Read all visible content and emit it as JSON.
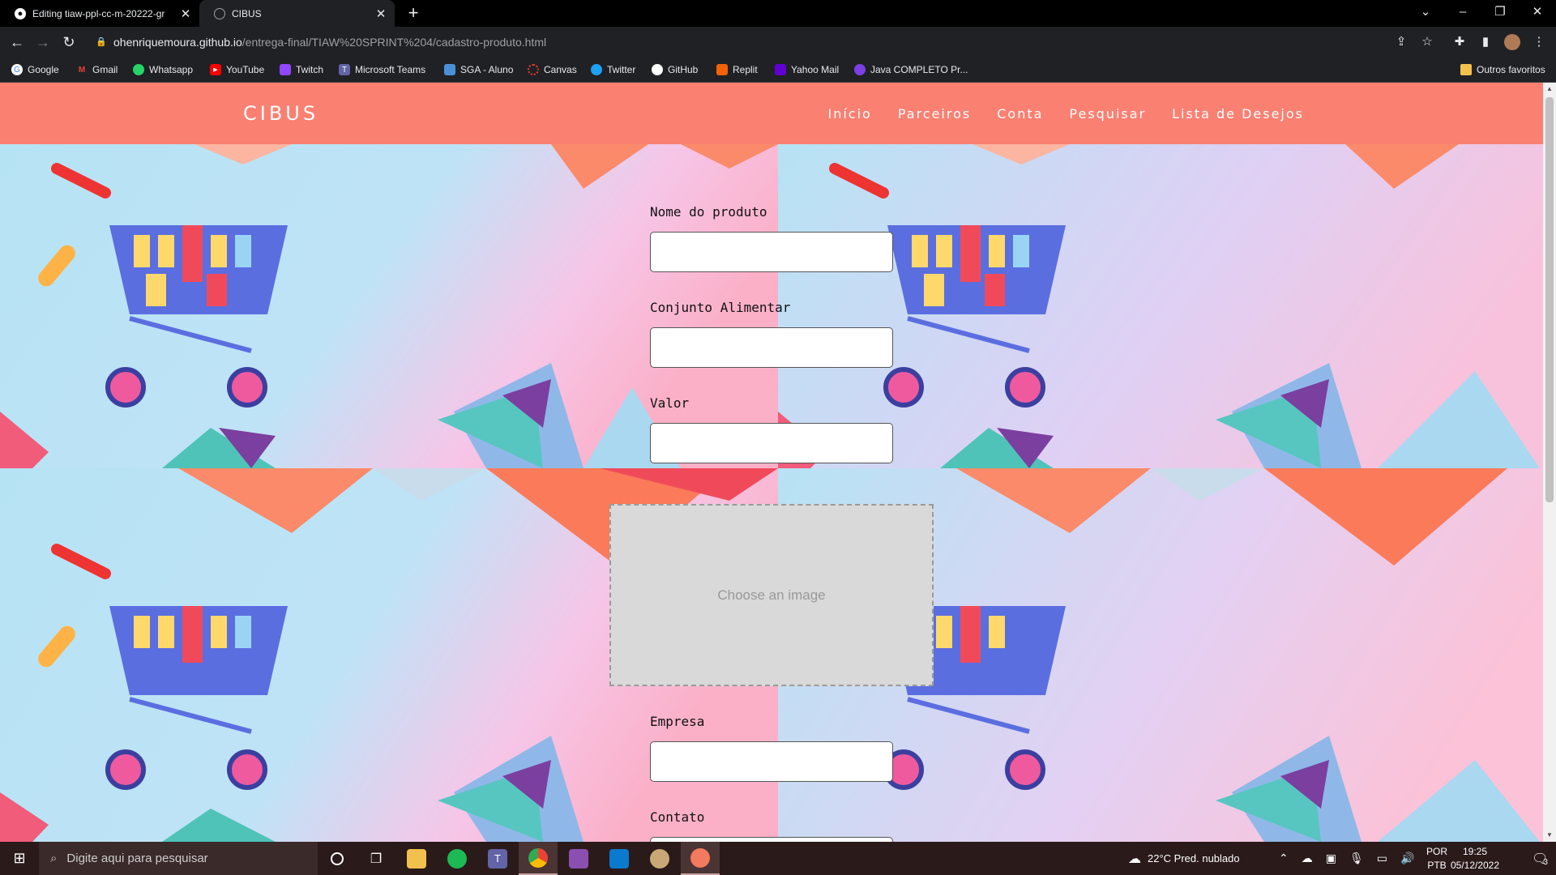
{
  "browser": {
    "tabs": [
      {
        "title": "Editing tiaw-ppl-cc-m-20222-gr",
        "icon": "github-icon"
      },
      {
        "title": "CIBUS",
        "icon": "globe-icon"
      }
    ],
    "url_host": "ohenriquemoura.github.io",
    "url_path": "/entrega-final/TIAW%20SPRINT%204/cadastro-produto.html",
    "bookmarks": [
      {
        "label": "Google",
        "color": "#ffffff"
      },
      {
        "label": "Gmail",
        "color": "#ea4335"
      },
      {
        "label": "Whatsapp",
        "color": "#25d366"
      },
      {
        "label": "YouTube",
        "color": "#ff0000"
      },
      {
        "label": "Twitch",
        "color": "#9146ff"
      },
      {
        "label": "Microsoft Teams",
        "color": "#6264a7"
      },
      {
        "label": "SGA - Aluno",
        "color": "#4a90d9"
      },
      {
        "label": "Canvas",
        "color": "#e13f2b"
      },
      {
        "label": "Twitter",
        "color": "#1da1f2"
      },
      {
        "label": "GitHub",
        "color": "#ffffff"
      },
      {
        "label": "Replit",
        "color": "#f26207"
      },
      {
        "label": "Yahoo Mail",
        "color": "#6001d2"
      },
      {
        "label": "Java COMPLETO Pr...",
        "color": "#7b3fe4"
      }
    ],
    "other_bookmarks": "Outros favoritos"
  },
  "site": {
    "brand": "CIBUS",
    "nav": [
      "Início",
      "Parceiros",
      "Conta",
      "Pesquisar",
      "Lista de Desejos"
    ],
    "accent": "#fa8072"
  },
  "form": {
    "product_name_label": "Nome do produto",
    "food_group_label": "Conjunto Alimentar",
    "value_label": "Valor",
    "image_placeholder": "Choose an image",
    "company_label": "Empresa",
    "contact_label": "Contato"
  },
  "taskbar": {
    "search_placeholder": "Digite aqui para pesquisar",
    "weather": "22°C  Pred. nublado",
    "lang_top": "POR",
    "lang_bottom": "PTB",
    "time": "19:25",
    "date": "05/12/2022",
    "notification_count": "3"
  }
}
